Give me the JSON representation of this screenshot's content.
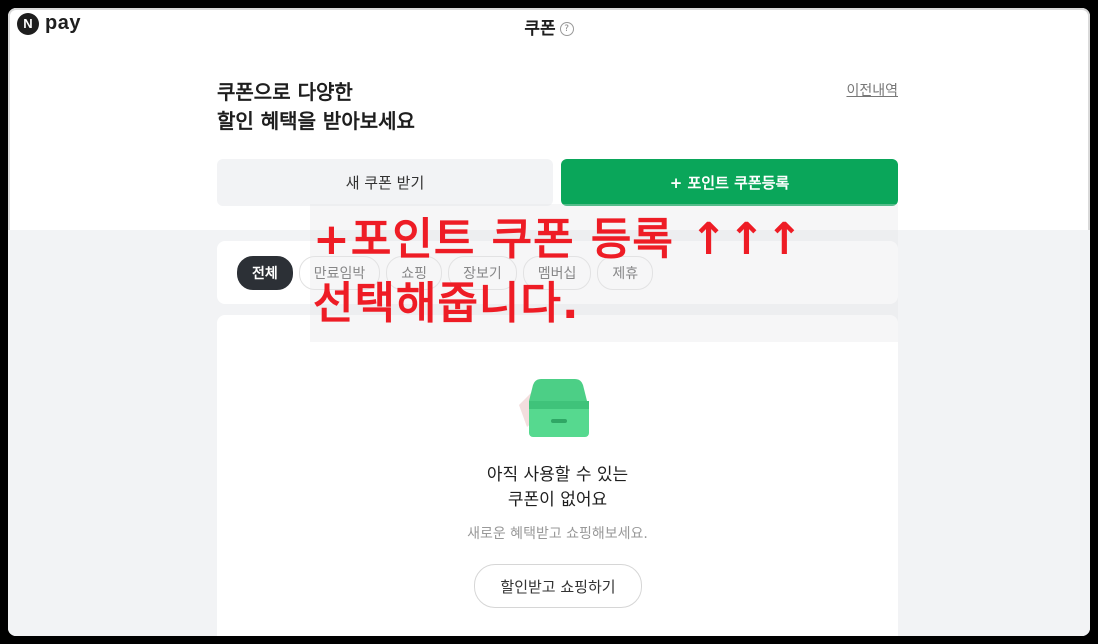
{
  "header": {
    "logo_letter": "N",
    "logo_text": "pay",
    "title": "쿠폰",
    "help_symbol": "?"
  },
  "headline": {
    "line1": "쿠폰으로 다양한",
    "line2": "할인 혜택을 받아보세요"
  },
  "history_link": "이전내역",
  "buttons": {
    "new_coupon": "새 쿠폰 받기",
    "register": "+ 포인트 쿠폰등록"
  },
  "filters": [
    "전체",
    "만료임박",
    "쇼핑",
    "장보기",
    "멤버십",
    "제휴"
  ],
  "empty_state": {
    "title_line1": "아직 사용할 수 있는",
    "title_line2": "쿠폰이 없어요",
    "subtitle": "새로운 혜택받고 쇼핑해보세요.",
    "action": "할인받고 쇼핑하기"
  },
  "annotation": {
    "line1": "+포인트 쿠폰 등록 ↑↑↑",
    "line2": "선택해줍니다."
  },
  "colors": {
    "brand_green": "#0aa65a",
    "annotation_red": "#ee1c25",
    "active_chip": "#2c3036"
  }
}
